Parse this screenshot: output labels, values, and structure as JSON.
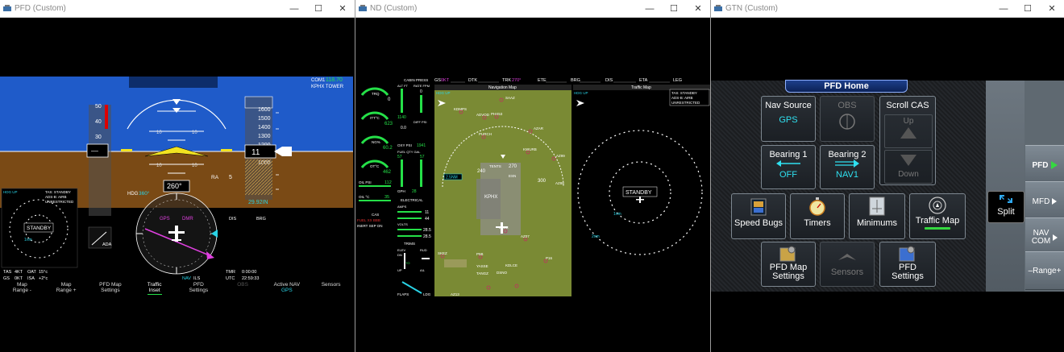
{
  "windows": {
    "pfd": {
      "title": "PFD (Custom)"
    },
    "nd": {
      "title": "ND (Custom)"
    },
    "gtn": {
      "title": "GTN (Custom)"
    }
  },
  "pfd": {
    "com1_label": "COM1",
    "com1_freq": "118.70",
    "com1_station": "KPHX TOWER",
    "altitude_tape": [
      "1600",
      "1500",
      "1400",
      "1300",
      "1200",
      "1100",
      "1000",
      "900"
    ],
    "alt_current": "11",
    "alt_baro": "29.92IN",
    "speed_tape": [
      "50",
      "40",
      "30",
      "20"
    ],
    "pitch_labels": [
      "10",
      "10",
      "10",
      "10"
    ],
    "ra_label": "RA",
    "ra_value": "5",
    "heading_label": "HDG",
    "heading_value": "360°",
    "heading_box": "260°",
    "ada_label": "ADA",
    "gps_label": "GPS",
    "dmr_label": "DMR",
    "dis_label": "DIS",
    "brg_label": "BRG",
    "traffic_lines": [
      "TAS: STANDBY",
      "ADS-B: AIRB",
      "UNRESTRICTED"
    ],
    "traffic_hdg": "HDG UP",
    "traffic_status": "STANDBY",
    "traffic_ring": "1nm",
    "info": {
      "tas_label": "TAS",
      "tas_value": "4KT",
      "oat_label": "OAT",
      "oat_value": "15°c",
      "gs_label": "GS",
      "gs_value": "0KT",
      "isa_label": "ISA",
      "isa_value": "+2°c",
      "nav_label": "NAV",
      "nav_value": "ILS",
      "tmr_label": "TMR",
      "tmr_value": "0:00:00",
      "utc_label": "UTC",
      "utc_value": "22:59:33"
    },
    "softkeys": [
      {
        "line1": "Map",
        "line2": "Range -"
      },
      {
        "line1": "Map",
        "line2": "Range +"
      },
      {
        "line1": "PFD Map",
        "line2": "Settings"
      },
      {
        "line1": "Traffic",
        "line2": "Inset"
      },
      {
        "line1": "PFD",
        "line2": "Settings"
      },
      {
        "line1": "OBS",
        "line2": ""
      },
      {
        "line1": "Active NAV",
        "line2": "GPS"
      },
      {
        "line1": "Sensors",
        "line2": ""
      }
    ]
  },
  "nd": {
    "gs_label": "GS",
    "gs_value": "0KT",
    "dtk_label": "DTK",
    "trk_label": "TRK",
    "trk_value": "270°",
    "ete_label": "ETE",
    "brg_label": "BRG",
    "dis_label": "DIS",
    "eta_label": "ETA",
    "leg_label": "LEG",
    "nav_map_title": "Navigation Map",
    "traffic_map_title": "Traffic Map",
    "nav_hdg": "HDG UP",
    "traffic_hdg": "HDG UP",
    "traffic_lines": [
      "TAS: STANDBY",
      "ADS-B: AIRB",
      "UNRESTRICTED"
    ],
    "traffic_status": "STANDBY",
    "ring_inner": "1nm",
    "ring_outer": "2nm",
    "map_center": "KPHX",
    "range_label": "2.5NM",
    "heading_ticks": [
      "240",
      "270",
      "300"
    ],
    "waypoints": [
      "KDMPS",
      "ADVOD",
      "PHX53",
      "PURCH",
      "AZAR",
      "KWURB",
      "AZ99",
      "SAAZ",
      "TENTS",
      "ESN",
      "DALE",
      "AZ07",
      "AZ88",
      "SKEZ",
      "P5B",
      "YASSE",
      "TANGZ",
      "DSNO",
      "KDLCE",
      "AZ13",
      "P16"
    ],
    "engine": {
      "trq_label": "TRQ",
      "trq_value": "0",
      "itt_label": "ITT°C",
      "itt_value": "623",
      "ng_label": "NG%",
      "ng_value": "60.2",
      "ott_label": "OT°C",
      "ott_value": "462",
      "oil_psi_label": "OIL PSI",
      "oil_psi_value": "112",
      "oil_c_label": "OIL °C",
      "oil_c_value": "35"
    },
    "cabin": {
      "title": "CABIN PRESS",
      "alt_label": "ALT FT",
      "rate_label": "RATE FPM",
      "rate_value": "0",
      "alt_value": "1140",
      "diff_label": "DIFF PSI",
      "diff_value": "0.0",
      "oxy_label": "OXY PSI",
      "oxy_value": "1941",
      "fuel_label": "FUEL QTY GAL",
      "fuel_left": "57",
      "fuel_right": "57",
      "gph_label": "GPH",
      "gph_value": "28"
    },
    "elec": {
      "title": "ELECTRICAL",
      "amps_label": "AMPS",
      "amps_value1": "11",
      "amps_value2": "44",
      "volts_label": "VOLTS",
      "volts_value1": "28.5",
      "volts_value2": "28.5"
    },
    "trims": {
      "title": "TRIMS",
      "elev_label": "ELEV",
      "rud_label": "RUD",
      "ail_label": "AIL",
      "dn_label": "DN",
      "up_label": "UP",
      "to_label": "TO"
    },
    "flaps_label": "FLAPS",
    "ldg_label": "LDG",
    "cas": {
      "title": "CAS",
      "msg1": "FUEL XX BBB",
      "msg2": "INERT SEP ON"
    }
  },
  "gtn": {
    "header": "PFD Home",
    "buttons": {
      "nav_source": {
        "label": "Nav Source",
        "value": "GPS"
      },
      "obs": {
        "label": "OBS"
      },
      "scroll_cas": {
        "label": "Scroll CAS",
        "up": "Up",
        "down": "Down"
      },
      "bearing1": {
        "label": "Bearing 1",
        "value": "OFF"
      },
      "bearing2": {
        "label": "Bearing 2",
        "value": "NAV1"
      },
      "speed_bugs": {
        "label": "Speed Bugs"
      },
      "timers": {
        "label": "Timers"
      },
      "minimums": {
        "label": "Minimums"
      },
      "traffic_map": {
        "label": "Traffic Map"
      },
      "pfd_map_settings": {
        "line1": "PFD Map",
        "line2": "Settings"
      },
      "sensors": {
        "label": "Sensors"
      },
      "pfd_settings": {
        "line1": "PFD",
        "line2": "Settings"
      },
      "split": {
        "label": "Split"
      }
    },
    "side": {
      "pfd": "PFD",
      "mfd": "MFD",
      "nav_com_1": "NAV",
      "nav_com_2": "COM",
      "range": "–Range+"
    }
  }
}
